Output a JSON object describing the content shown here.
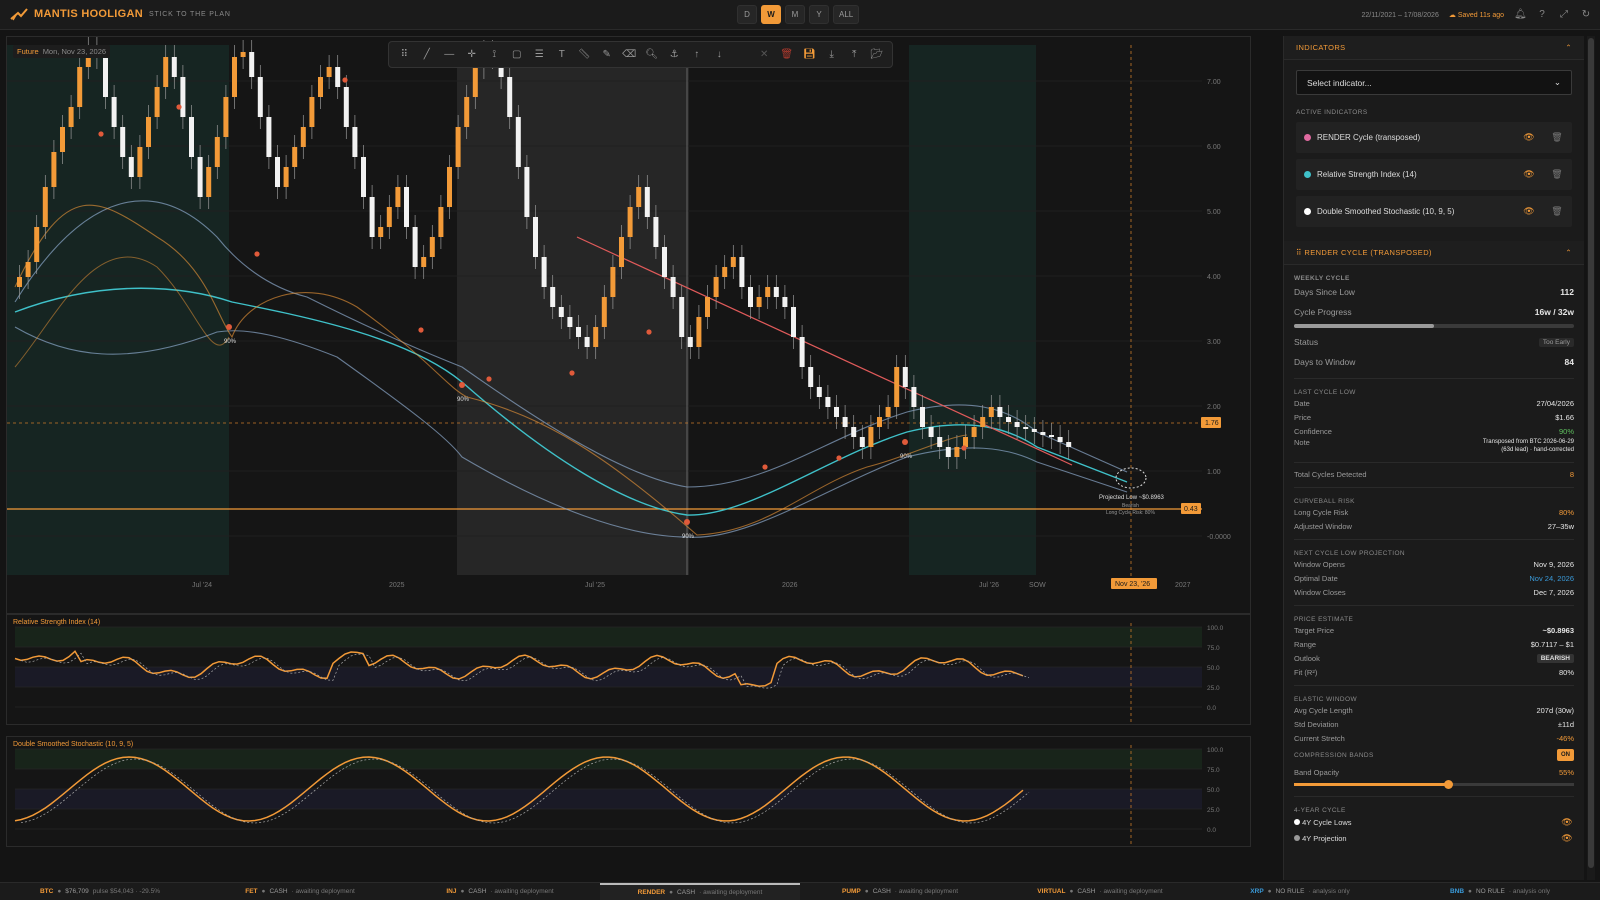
{
  "app": {
    "title": "MANTIS HOOLIGAN",
    "tagline": "STICK TO THE PLAN"
  },
  "timeframes": [
    {
      "label": "D",
      "active": false
    },
    {
      "label": "W",
      "active": true
    },
    {
      "label": "M",
      "active": false
    },
    {
      "label": "Y",
      "active": false
    },
    {
      "label": "ALL",
      "active": false
    }
  ],
  "topright": {
    "date_range": "22/11/2021 – 17/08/2026",
    "saved": "Saved 11s ago"
  },
  "chart": {
    "future_label": "Future",
    "cursor_date": "Mon, Nov 23, 2026",
    "y_ticks": [
      "7.00",
      "6.00",
      "5.00",
      "4.00",
      "3.00",
      "2.00",
      "1.00",
      "-0.0000"
    ],
    "x_ticks": [
      "Jul '24",
      "2025",
      "Jul '25",
      "2026",
      "Jul '26",
      "SOW",
      "2027"
    ],
    "price_tag": "1.76",
    "low_tag": "0.43",
    "cursor_tag": "Nov 23, '26",
    "projection_label": "Projected Low ~$0.8963",
    "projection_sub1": "Bearish",
    "projection_sub2": "Long Cycle Risk: 80%",
    "cycle_pct": "90%"
  },
  "rsi_pane": {
    "title": "Relative Strength Index (14)",
    "ticks": [
      "100.0",
      "75.0",
      "50.0",
      "25.0",
      "0.0"
    ]
  },
  "stoch_pane": {
    "title": "Double Smoothed Stochastic (10, 9, 5)",
    "ticks": [
      "100.0",
      "75.0",
      "50.0",
      "25.0",
      "0.0"
    ]
  },
  "indicators": {
    "header": "INDICATORS",
    "select_placeholder": "Select indicator...",
    "active_header": "ACTIVE INDICATORS",
    "items": [
      {
        "name": "RENDER Cycle (transposed)",
        "color": "#e06aa0"
      },
      {
        "name": "Relative Strength Index (14)",
        "color": "#3fc1c9"
      },
      {
        "name": "Double Smoothed Stochastic (10, 9, 5)",
        "color": "#ffffff"
      }
    ]
  },
  "render_cycle": {
    "header": "RENDER CYCLE (TRANSPOSED)",
    "weekly_cycle": "WEEKLY CYCLE",
    "days_since_low_label": "Days Since Low",
    "days_since_low": "112",
    "cycle_progress_label": "Cycle Progress",
    "cycle_progress": "16w / 32w",
    "cycle_progress_fraction": 0.5,
    "status_label": "Status",
    "status": "Too Early",
    "days_to_window_label": "Days to Window",
    "days_to_window": "84",
    "last_cycle_low": "LAST CYCLE LOW",
    "date_label": "Date",
    "date": "27/04/2026",
    "price_label": "Price",
    "price": "$1.66",
    "confidence_label": "Confidence",
    "confidence": "90%",
    "note_label": "Note",
    "note1": "Transposed from BTC 2026-06-29",
    "note2": "(63d lead) · hand-corrected",
    "total_cycles_label": "Total Cycles Detected",
    "total_cycles": "8",
    "curveball_risk": "CURVEBALL RISK",
    "long_cycle_risk_label": "Long Cycle Risk",
    "long_cycle_risk": "80%",
    "adjusted_window_label": "Adjusted Window",
    "adjusted_window": "27–35w",
    "next_projection": "NEXT CYCLE LOW PROJECTION",
    "window_opens_label": "Window Opens",
    "window_opens": "Nov 9, 2026",
    "optimal_date_label": "Optimal Date",
    "optimal_date": "Nov 24, 2026",
    "window_closes_label": "Window Closes",
    "window_closes": "Dec 7, 2026",
    "price_estimate": "PRICE ESTIMATE",
    "target_price_label": "Target Price",
    "target_price": "~$0.8963",
    "range_label": "Range",
    "range": "$0.7117 – $1",
    "outlook_label": "Outlook",
    "outlook": "BEARISH",
    "fit_label": "Fit (R²)",
    "fit": "80%",
    "elastic_window": "ELASTIC WINDOW",
    "avg_cycle_label": "Avg Cycle Length",
    "avg_cycle": "207d (30w)",
    "std_dev_label": "Std Deviation",
    "std_dev": "±11d",
    "current_stretch_label": "Current Stretch",
    "current_stretch": "-46%",
    "compression_bands": "COMPRESSION BANDS",
    "compression_toggle": "ON",
    "band_opacity_label": "Band Opacity",
    "band_opacity": "55%",
    "band_opacity_value": 0.55,
    "four_year": "4-YEAR CYCLE",
    "four_year_lows": "4Y Cycle Lows",
    "four_year_projection": "4Y Projection"
  },
  "bottom_tabs": [
    {
      "sym": "BTC",
      "price": "$76,709",
      "info": "pulse $54,043 · -29.5%",
      "blue": false,
      "active": false
    },
    {
      "sym": "FET",
      "price": "CASH",
      "info": "· awaiting deployment",
      "blue": false,
      "active": false
    },
    {
      "sym": "INJ",
      "price": "CASH",
      "info": "· awaiting deployment",
      "blue": false,
      "active": false
    },
    {
      "sym": "RENDER",
      "price": "CASH",
      "info": "· awaiting deployment",
      "blue": false,
      "active": true
    },
    {
      "sym": "PUMP",
      "price": "CASH",
      "info": "· awaiting deployment",
      "blue": false,
      "active": false
    },
    {
      "sym": "VIRTUAL",
      "price": "CASH",
      "info": "· awaiting deployment",
      "blue": false,
      "active": false
    },
    {
      "sym": "XRP",
      "price": "NO RULE",
      "info": "· analysis only",
      "blue": true,
      "active": false
    },
    {
      "sym": "BNB",
      "price": "NO RULE",
      "info": "· analysis only",
      "blue": true,
      "active": false
    }
  ]
}
